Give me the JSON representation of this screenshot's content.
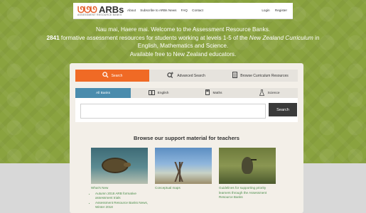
{
  "header": {
    "logo_mark": "ᘎᘎᘎ",
    "logo_word": "ARBs",
    "logo_sub": "ASSESSMENT RESOURCE BANKS",
    "nav": [
      "About",
      "Subscribe to ARBs News",
      "FAQ",
      "Contact"
    ],
    "auth": [
      "Login",
      "Register"
    ]
  },
  "hero": {
    "line1": "Nau mai, Haere mai. Welcome to the Assessment Resource Banks.",
    "count": "2841",
    "line2a": " formative assessment resources for students working at levels 1-5 of the ",
    "line2b": "New Zealand Curriculum",
    "line2c": " in",
    "line3": "English, Mathematics and Science.",
    "line4": "Available free to New Zealand educators."
  },
  "mode_tabs": [
    {
      "label": "Search",
      "icon": "search-icon"
    },
    {
      "label": "Advanced Search",
      "icon": "advanced-search-icon"
    },
    {
      "label": "Browse Curriculum Resources",
      "icon": "document-icon"
    }
  ],
  "bank_tabs": [
    {
      "label": "All Banks"
    },
    {
      "label": "English",
      "icon": "book-icon"
    },
    {
      "label": "Maths",
      "icon": "calculator-icon"
    },
    {
      "label": "Science",
      "icon": "flask-icon"
    }
  ],
  "search": {
    "placeholder": "",
    "button": "Search"
  },
  "support": {
    "title": "Browse our support material for teachers",
    "cards": [
      {
        "title": "What's New",
        "items": [
          "Autumn 2018 ARB formative assessment trials",
          "Assessment Resource Banks News, Winter 2018"
        ]
      },
      {
        "title": "Conceptual maps",
        "items": []
      },
      {
        "title": "Guidelines for supporting priority learners through the Assessment Resource Banks",
        "items": []
      }
    ]
  },
  "colors": {
    "accent_orange": "#f06a25",
    "tab_blue": "#4a8cad",
    "green_bg": "#8aa33f",
    "link_green": "#4a8c4a"
  }
}
